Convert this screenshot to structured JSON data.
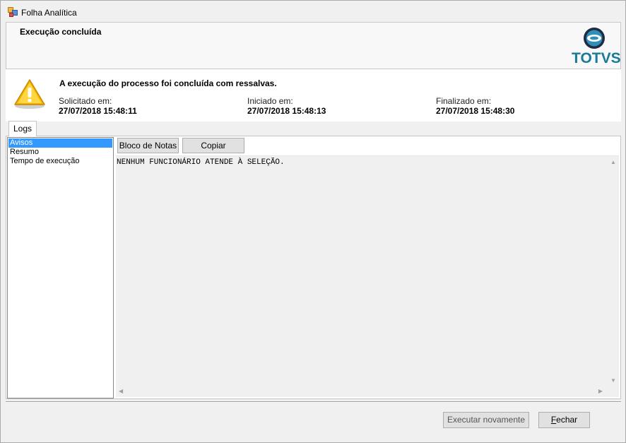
{
  "window": {
    "title": "Folha Analítica",
    "app_icon": "app-window-icon"
  },
  "header": {
    "title": "Execução concluída",
    "logo_text": "TOTVS",
    "logo_color": "#177b99"
  },
  "info": {
    "icon": "warning-icon",
    "message": "A execução do processo foi concluída com ressalvas.",
    "requested": {
      "label": "Solicitado em:",
      "value": "27/07/2018 15:48:11"
    },
    "started": {
      "label": "Iniciado em:",
      "value": "27/07/2018 15:48:13"
    },
    "finished": {
      "label": "Finalizado em:",
      "value": "27/07/2018 15:48:30"
    }
  },
  "tabs": [
    {
      "label": "Logs",
      "active": true
    }
  ],
  "logs": {
    "items": [
      {
        "label": "Avisos",
        "selected": true
      },
      {
        "label": "Resumo",
        "selected": false
      },
      {
        "label": "Tempo de execução",
        "selected": false
      }
    ],
    "selection_color": "#3399ff"
  },
  "toolbar": {
    "notepad_label": "Bloco de Notas",
    "copy_label": "Copiar"
  },
  "log_text": "NENHUM FUNCIONÁRIO ATENDE À SELEÇÃO.",
  "footer": {
    "run_again_label": "Executar novamente",
    "close_label": "Fechar"
  }
}
